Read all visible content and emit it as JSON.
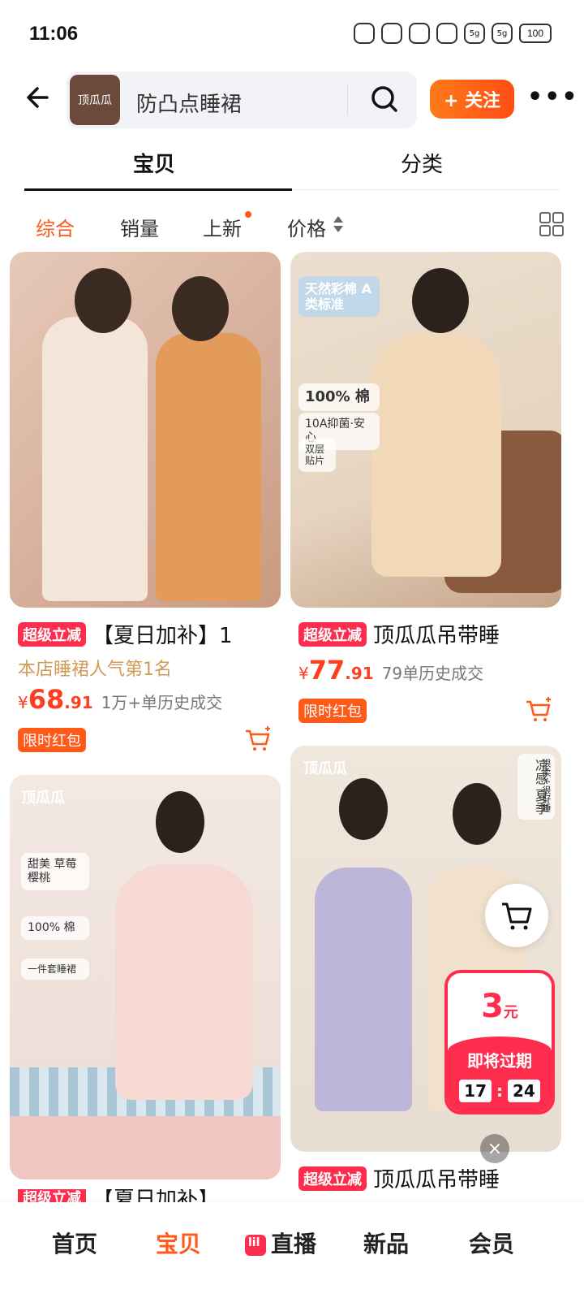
{
  "status_bar": {
    "time": "11:06",
    "battery": "100",
    "signal_1": "5g",
    "signal_2": "5g"
  },
  "header": {
    "logo_text": "顶瓜瓜",
    "search_query": "防凸点睡裙",
    "follow_label": "+ 关注"
  },
  "tabs": [
    {
      "label": "宝贝",
      "active": true
    },
    {
      "label": "分类",
      "active": false
    }
  ],
  "filters": [
    {
      "label": "综合",
      "active": true
    },
    {
      "label": "销量",
      "active": false
    },
    {
      "label": "上新",
      "active": false
    },
    {
      "label": "价格",
      "active": false
    }
  ],
  "products": [
    {
      "tag": "超级立减",
      "title": "【夏日加补】1",
      "subtitle": "本店睡裙人气第1名",
      "price_symbol": "¥",
      "price_int": "68",
      "price_dec": ".91",
      "sales": "1万+单历史成交",
      "promo": "限时红包"
    },
    {
      "tag": "超级立减",
      "title": "顶瓜瓜吊带睡",
      "price_symbol": "¥",
      "price_int": "77",
      "price_dec": ".91",
      "sales": "79单历史成交",
      "promo": "限时红包",
      "image_badges": [
        "天然彩棉 A类标准",
        "100% 棉",
        "10A抑菌·安心",
        "双层 贴片"
      ]
    },
    {
      "brand": "顶瓜瓜",
      "image_badges": [
        "甜美 草莓樱桃",
        "100% 棉",
        "一件套睡裙"
      ],
      "tag": "超级立减",
      "title": "【夏日加补】"
    },
    {
      "brand": "顶瓜瓜",
      "image_badges": [
        "凉感 夏季",
        "很柔 / 很好睡"
      ],
      "tag": "超级立减",
      "title": "顶瓜瓜吊带睡"
    }
  ],
  "coupon": {
    "amount": "3",
    "unit": "元",
    "label": "即将过期",
    "minutes": "17",
    "separator": ":",
    "seconds": "24"
  },
  "close_label": "×",
  "bottom_nav": [
    {
      "label": "首页",
      "active": false
    },
    {
      "label": "宝贝",
      "active": true
    },
    {
      "label": "直播",
      "active": false
    },
    {
      "label": "新品",
      "active": false
    },
    {
      "label": "会员",
      "active": false
    }
  ],
  "colors": {
    "accent": "#ff5a1a",
    "tag_red": "#ff2d4d",
    "price": "#ff3d1f",
    "subtitle": "#d19a55"
  }
}
